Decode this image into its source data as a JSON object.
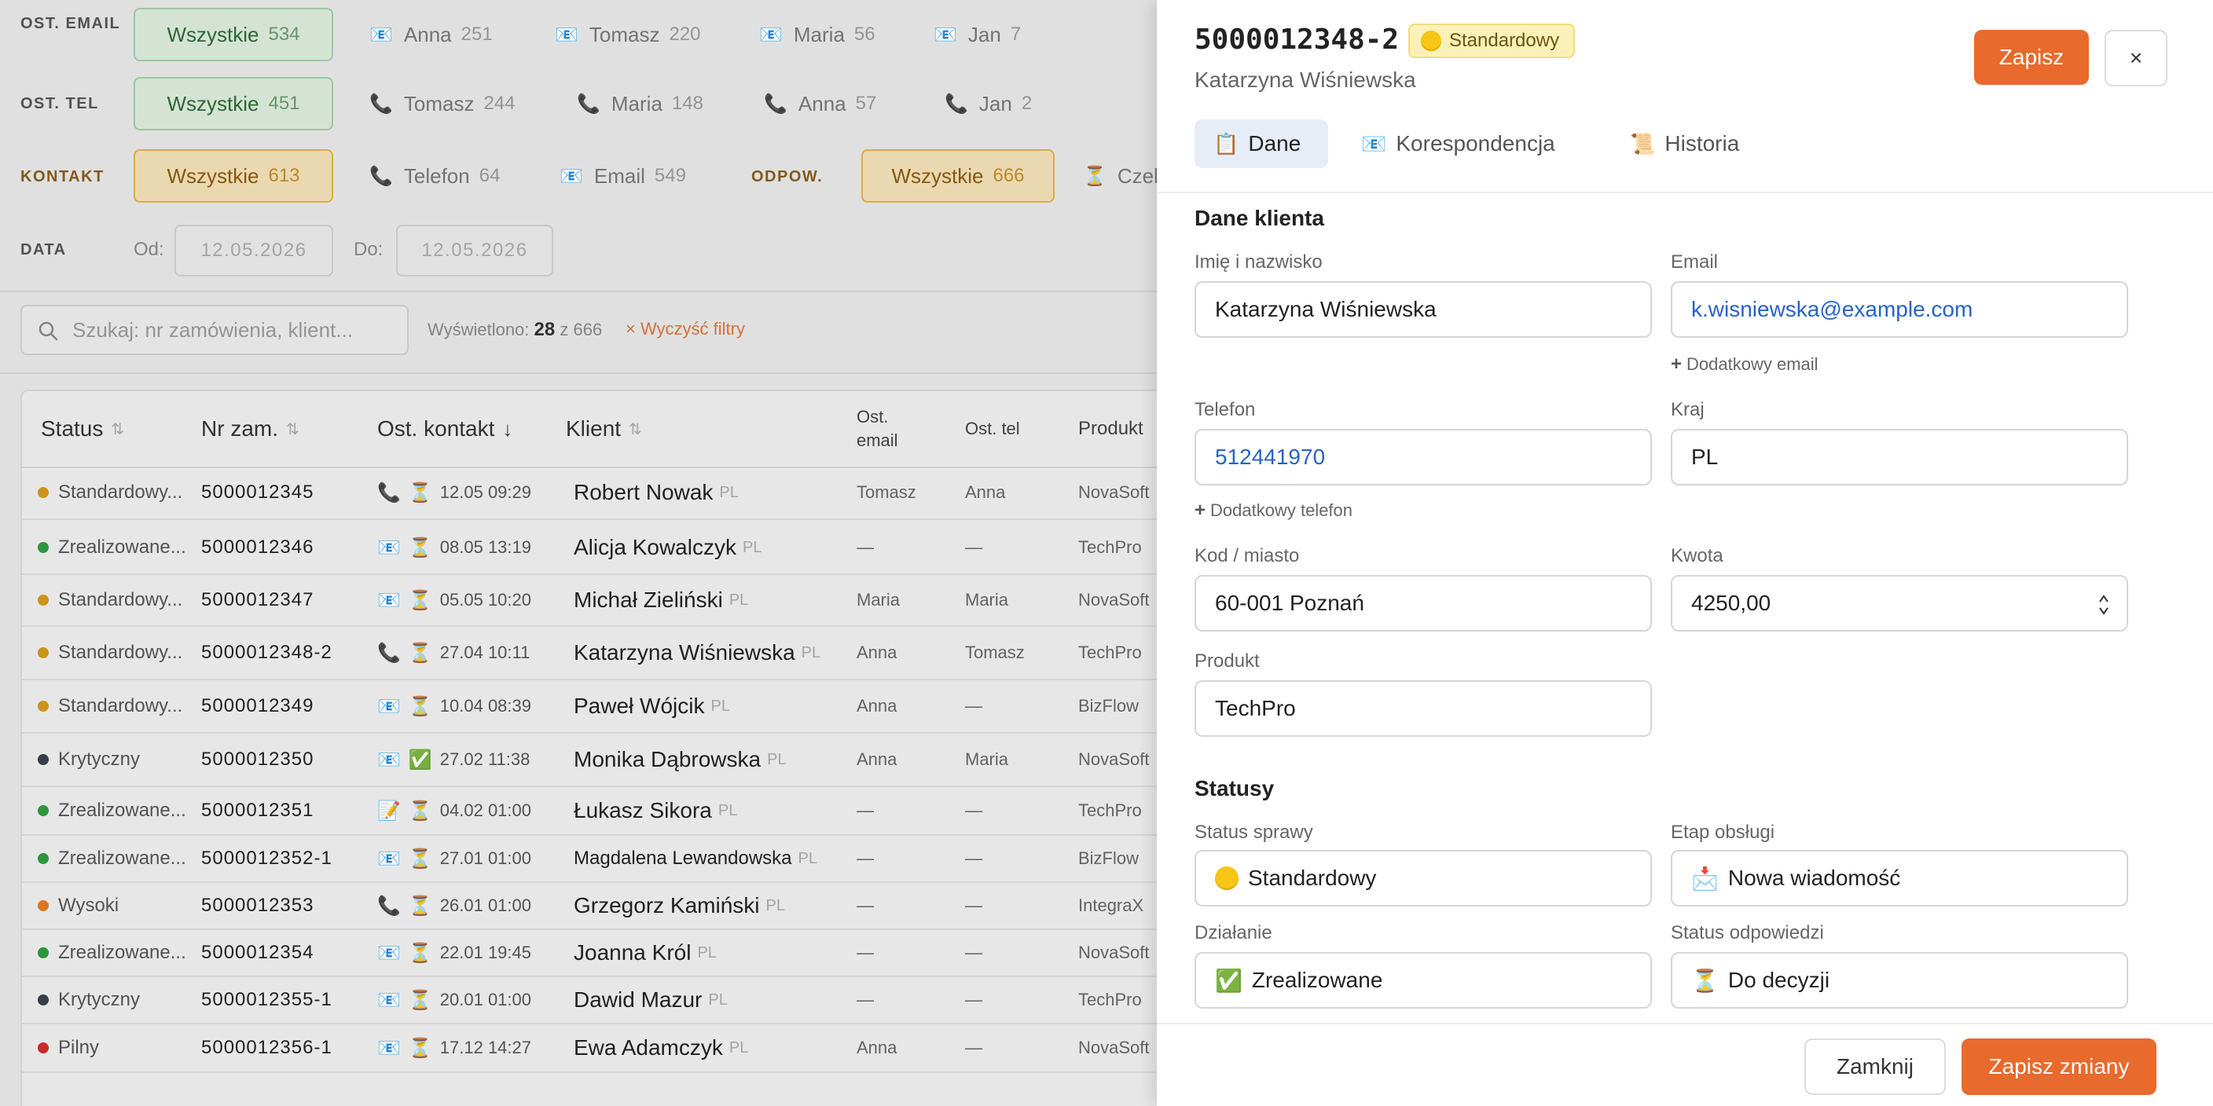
{
  "filters": {
    "ost_email": {
      "label": "OST. EMAIL",
      "all": {
        "label": "Wszystkie",
        "count": "534"
      },
      "items": [
        {
          "label": "Anna",
          "count": "251"
        },
        {
          "label": "Tomasz",
          "count": "220"
        },
        {
          "label": "Maria",
          "count": "56"
        },
        {
          "label": "Jan",
          "count": "7"
        }
      ]
    },
    "ost_tel": {
      "label": "OST. TEL",
      "all": {
        "label": "Wszystkie",
        "count": "451"
      },
      "items": [
        {
          "label": "Tomasz",
          "count": "244"
        },
        {
          "label": "Maria",
          "count": "148"
        },
        {
          "label": "Anna",
          "count": "57"
        },
        {
          "label": "Jan",
          "count": "2"
        }
      ]
    },
    "kontakt": {
      "label": "KONTAKT",
      "all": {
        "label": "Wszystkie",
        "count": "613"
      },
      "items": [
        {
          "label": "Telefon",
          "count": "64"
        },
        {
          "label": "Email",
          "count": "549"
        }
      ]
    },
    "odpow": {
      "label": "ODPOW.",
      "all": {
        "label": "Wszystkie",
        "count": "666"
      },
      "items": [
        {
          "label": "Czek",
          "count": ""
        }
      ]
    },
    "data": {
      "label": "DATA",
      "from_label": "Od:",
      "from_value": "12.05.2026",
      "to_label": "Do:",
      "to_value": "12.05.2026"
    }
  },
  "search": {
    "placeholder": "Szukaj: nr zamówienia, klient...",
    "shown_label": "Wyświetlono:",
    "shown_count": "28",
    "shown_of": "z 666",
    "clear_label": "× Wyczyść filtry"
  },
  "table": {
    "headers": {
      "status": "Status",
      "nr": "Nr zam.",
      "kontakt": "Ost. kontakt",
      "klient": "Klient",
      "email1": "Ost.",
      "email2": "email",
      "tel": "Ost. tel",
      "produkt": "Produkt"
    },
    "rows": [
      {
        "status": "Standardowy...",
        "status_color": "#d19a1c",
        "nr": "5000012345",
        "icon": "phone",
        "check": "hourglass",
        "date": "12.05 09:29",
        "klient": "Robert Nowak",
        "country": "PL",
        "email": "Tomasz",
        "tel": "Anna",
        "produkt": "NovaSoft"
      },
      {
        "status": "Zrealizowane...",
        "status_color": "#2e9b3f",
        "nr": "5000012346",
        "icon": "email",
        "check": "hourglass",
        "date": "08.05 13:19",
        "klient": "Alicja Kowalczyk",
        "country": "PL",
        "email": "—",
        "tel": "—",
        "produkt": "TechPro"
      },
      {
        "status": "Standardowy...",
        "status_color": "#d19a1c",
        "nr": "5000012347",
        "icon": "email",
        "check": "hourglass",
        "date": "05.05 10:20",
        "klient": "Michał Zieliński",
        "country": "PL",
        "email": "Maria",
        "tel": "Maria",
        "produkt": "NovaSoft"
      },
      {
        "status": "Standardowy...",
        "status_color": "#d19a1c",
        "nr": "5000012348-2",
        "icon": "phone",
        "check": "hourglass",
        "date": "27.04 10:11",
        "klient": "Katarzyna Wiśniewska",
        "country": "PL",
        "email": "Anna",
        "tel": "Tomasz",
        "produkt": "TechPro"
      },
      {
        "status": "Standardowy...",
        "status_color": "#d19a1c",
        "nr": "5000012349",
        "icon": "email",
        "check": "hourglass",
        "date": "10.04 08:39",
        "klient": "Paweł Wójcik",
        "country": "PL",
        "email": "Anna",
        "tel": "—",
        "produkt": "BizFlow"
      },
      {
        "status": "Krytyczny",
        "status_color": "#3b3f4a",
        "nr": "5000012350",
        "icon": "email",
        "check": "done",
        "date": "27.02 11:38",
        "klient": "Monika Dąbrowska",
        "country": "PL",
        "email": "Anna",
        "tel": "Maria",
        "produkt": "NovaSoft"
      },
      {
        "status": "Zrealizowane...",
        "status_color": "#2e9b3f",
        "nr": "5000012351",
        "icon": "memo",
        "check": "hourglass",
        "date": "04.02 01:00",
        "klient": "Łukasz Sikora",
        "country": "PL",
        "email": "—",
        "tel": "—",
        "produkt": "TechPro"
      },
      {
        "status": "Zrealizowane...",
        "status_color": "#2e9b3f",
        "nr": "5000012352-1",
        "icon": "email",
        "check": "hourglass",
        "date": "27.01 01:00",
        "klient": "Magdalena Lewandowska",
        "country": "PL",
        "email": "—",
        "tel": "—",
        "produkt": "BizFlow"
      },
      {
        "status": "Wysoki",
        "status_color": "#e07a24",
        "nr": "5000012353",
        "icon": "phone",
        "check": "hourglass",
        "date": "26.01 01:00",
        "klient": "Grzegorz Kamiński",
        "country": "PL",
        "email": "—",
        "tel": "—",
        "produkt": "IntegraX"
      },
      {
        "status": "Zrealizowane...",
        "status_color": "#2e9b3f",
        "nr": "5000012354",
        "icon": "email",
        "check": "hourglass",
        "date": "22.01 19:45",
        "klient": "Joanna Król",
        "country": "PL",
        "email": "—",
        "tel": "—",
        "produkt": "NovaSoft"
      },
      {
        "status": "Krytyczny",
        "status_color": "#3b3f4a",
        "nr": "5000012355-1",
        "icon": "email",
        "check": "hourglass",
        "date": "20.01 01:00",
        "klient": "Dawid Mazur",
        "country": "PL",
        "email": "—",
        "tel": "—",
        "produkt": "TechPro"
      },
      {
        "status": "Pilny",
        "status_color": "#d22c2c",
        "nr": "5000012356-1",
        "icon": "email",
        "check": "hourglass",
        "date": "17.12 14:27",
        "klient": "Ewa Adamczyk",
        "country": "PL",
        "email": "Anna",
        "tel": "—",
        "produkt": "NovaSoft"
      }
    ]
  },
  "panel": {
    "title": "5000012348-2",
    "badge": "Standardowy",
    "subtitle": "Katarzyna Wiśniewska",
    "save_label": "Zapisz",
    "close_x": "×",
    "tabs": [
      {
        "label": "Dane",
        "icon": "clipboard-icon"
      },
      {
        "label": "Korespondencja",
        "icon": "email-icon"
      },
      {
        "label": "Historia",
        "icon": "scroll-icon"
      }
    ],
    "section_client": "Dane klienta",
    "fields": {
      "name": {
        "label": "Imię i nazwisko",
        "value": "Katarzyna Wiśniewska"
      },
      "email": {
        "label": "Email",
        "value": "k.wisniewska@example.com"
      },
      "add_email": "Dodatkowy email",
      "phone": {
        "label": "Telefon",
        "value": "512441970"
      },
      "country": {
        "label": "Kraj",
        "value": "PL"
      },
      "add_phone": "Dodatkowy telefon",
      "city": {
        "label": "Kod / miasto",
        "value": "60-001 Poznań"
      },
      "amount": {
        "label": "Kwota",
        "value": "4250,00"
      },
      "product": {
        "label": "Produkt",
        "value": "TechPro"
      }
    },
    "section_status": "Statusy",
    "statuses": {
      "case": {
        "label": "Status sprawy",
        "value": "Standardowy"
      },
      "stage": {
        "label": "Etap obsługi",
        "value": "Nowa wiadomość"
      },
      "action": {
        "label": "Działanie",
        "value": "Zrealizowane"
      },
      "reply": {
        "label": "Status odpowiedzi",
        "value": "Do decyzji"
      }
    },
    "close_label": "Zamknij",
    "save_changes_label": "Zapisz zmiany"
  },
  "colors": {
    "accent": "#e86a2c",
    "link": "#2563c9"
  }
}
